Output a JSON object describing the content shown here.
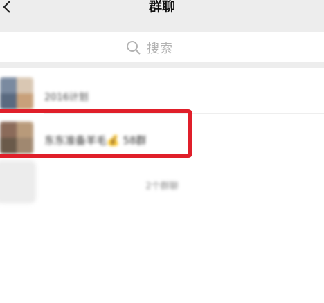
{
  "nav": {
    "back_icon": "chevron-left-icon",
    "title": "群聊"
  },
  "search": {
    "icon": "search-icon",
    "placeholder": "搜索"
  },
  "groups": [
    {
      "name": "2016计划",
      "avatar_colors": [
        "#7a8aa0",
        "#d9c7b3",
        "#5a6a80",
        "#c8a07a"
      ]
    },
    {
      "name": "东东准备羊毛💰 58群",
      "avatar_colors": [
        "#8b6b5a",
        "#b89a7a",
        "#6a5a4a",
        "#a08870"
      ]
    }
  ],
  "group_count": "2个群聊",
  "highlight_color": "#e01f2a"
}
